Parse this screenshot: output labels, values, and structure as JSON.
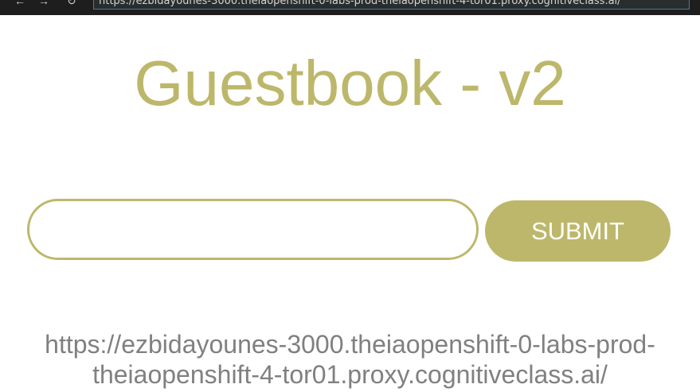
{
  "browser": {
    "back_icon": "arrow-left-icon",
    "back_glyph": "←",
    "forward_icon": "arrow-right-icon",
    "forward_glyph": "→",
    "reload_icon": "reload-icon",
    "reload_glyph": "↻",
    "address_value": "https://ezbidayounes-3000.theiaopenshift-0-labs-prod-theiaopenshift-4-tor01.proxy.cognitiveclass.ai/"
  },
  "page": {
    "title": "Guestbook - v2",
    "input_value": "",
    "submit_label": "SUBMIT",
    "host_line1": "https://ezbidayounes-3000.theiaopenshift-0-labs-prod-",
    "host_line2": "theiaopenshift-4-tor01.proxy.cognitiveclass.ai/"
  },
  "colors": {
    "accent": "#bdb76b",
    "host_text": "#808080",
    "browser_bar": "#1e1e1e"
  }
}
